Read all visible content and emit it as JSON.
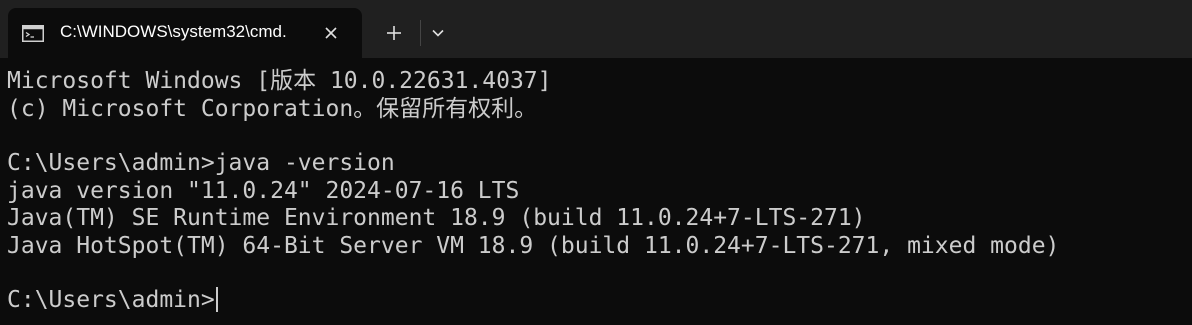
{
  "tab": {
    "icon": "console-icon",
    "title": "C:\\WINDOWS\\system32\\cmd.",
    "close_icon": "close-icon"
  },
  "toolbar": {
    "new_tab_icon": "plus-icon",
    "dropdown_icon": "chevron-down-icon"
  },
  "console": {
    "lines": [
      "Microsoft Windows [版本 10.0.22631.4037]",
      "(c) Microsoft Corporation。保留所有权利。",
      "",
      "C:\\Users\\admin>java -version",
      "java version \"11.0.24\" 2024-07-16 LTS",
      "Java(TM) SE Runtime Environment 18.9 (build 11.0.24+7-LTS-271)",
      "Java HotSpot(TM) 64-Bit Server VM 18.9 (build 11.0.24+7-LTS-271, mixed mode)",
      "",
      "C:\\Users\\admin>"
    ]
  },
  "colors": {
    "titlebar_bg": "#202020",
    "terminal_bg": "#0c0c0c",
    "text": "#cccccc"
  }
}
